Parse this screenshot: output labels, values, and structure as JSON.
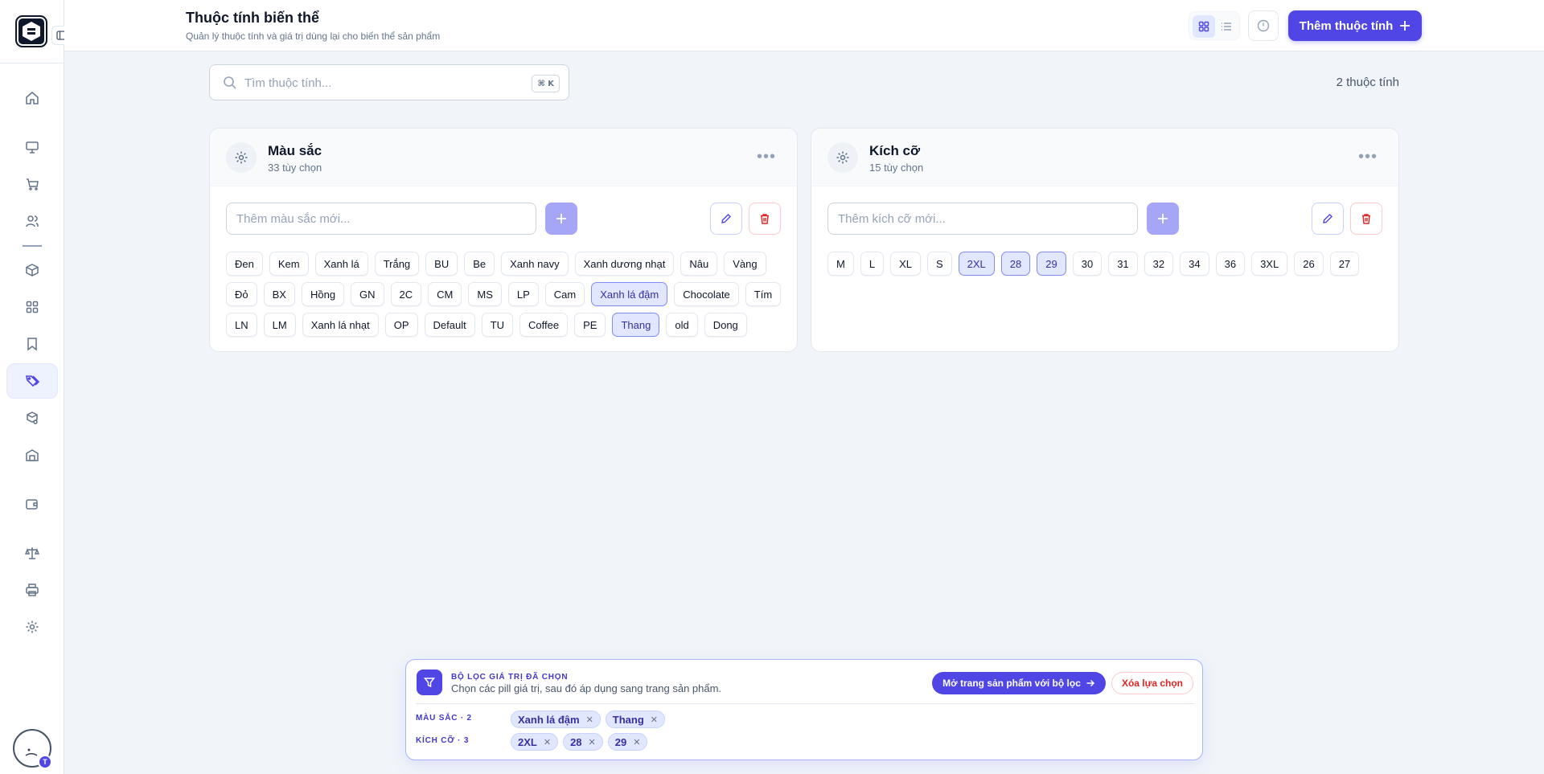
{
  "header": {
    "title": "Thuộc tính biến thể",
    "subtitle": "Quản lý thuộc tính và giá trị dùng lại cho biến thể sản phẩm",
    "add_button_label": "Thêm thuộc tính"
  },
  "search": {
    "placeholder": "Tìm thuộc tính...",
    "shortcut": "⌘ K",
    "count_label": "2 thuộc tính"
  },
  "attributes": [
    {
      "title": "Màu sắc",
      "subtitle": "33 tùy chọn",
      "input_placeholder": "Thêm màu sắc mới...",
      "values": [
        "Đen",
        "Kem",
        "Xanh lá",
        "Trắng",
        "BU",
        "Be",
        "Xanh navy",
        "Xanh dương nhạt",
        "Nâu",
        "Vàng",
        "Đỏ",
        "BX",
        "Hồng",
        "GN",
        "2C",
        "CM",
        "MS",
        "LP",
        "Cam",
        "Xanh lá đậm",
        "Chocolate",
        "Tím",
        "LN",
        "LM",
        "Xanh lá nhạt",
        "OP",
        "Default",
        "TU",
        "Coffee",
        "PE",
        "Thang",
        "old",
        "Dong"
      ],
      "selected": [
        "Xanh lá đậm",
        "Thang"
      ]
    },
    {
      "title": "Kích cỡ",
      "subtitle": "15 tùy chọn",
      "input_placeholder": "Thêm kích cỡ mới...",
      "values": [
        "M",
        "L",
        "XL",
        "S",
        "2XL",
        "28",
        "29",
        "30",
        "31",
        "32",
        "34",
        "36",
        "3XL",
        "26",
        "27"
      ],
      "selected": [
        "2XL",
        "28",
        "29"
      ]
    }
  ],
  "filter_panel": {
    "title": "BỘ LỌC GIÁ TRỊ ĐÃ CHỌN",
    "description": "Chọn các pill giá trị, sau đó áp dụng sang trang sản phẩm.",
    "open_button_label": "Mở trang sản phẩm với bộ lọc",
    "clear_button_label": "Xóa lựa chọn",
    "rows": [
      {
        "label": "MÀU SẮC · 2",
        "chips": [
          "Xanh lá đậm",
          "Thang"
        ]
      },
      {
        "label": "KÍCH CỠ · 3",
        "chips": [
          "2XL",
          "28",
          "29"
        ]
      }
    ]
  },
  "user": {
    "avatar_badge": "T"
  },
  "colors": {
    "accent": "#4f46e5",
    "danger": "#dc2626",
    "selected_bg": "#e0e7ff"
  },
  "sidebar": {
    "icons": [
      "home-icon",
      "monitor-icon",
      "cart-icon",
      "users-icon",
      "package-icon",
      "grid-icon",
      "bookmark-icon",
      "tags-icon",
      "box-settings-icon",
      "warehouse-icon",
      "wallet-icon",
      "scale-icon",
      "printer-icon",
      "settings-icon"
    ],
    "active": "tags-icon"
  }
}
